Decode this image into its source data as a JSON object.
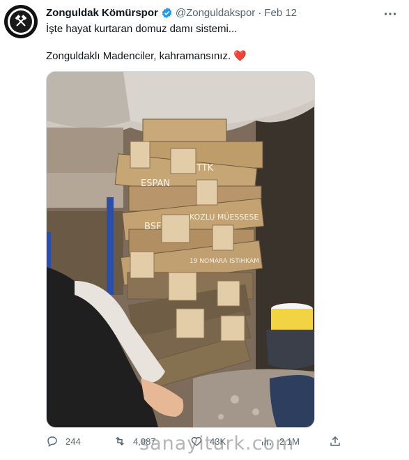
{
  "author": {
    "name": "Zonguldak Kömürspor",
    "handle": "@Zonguldakspor",
    "separator": "·",
    "date": "Feb 12",
    "verified": true
  },
  "tweet": {
    "line1": "İşte hayat kurtaran domuz damı sistemi...",
    "line2": "Zonguldaklı Madenciler, kahramansınız.",
    "emoji": "❤️"
  },
  "media": {
    "block_inscriptions": [
      "TTK",
      "ESPAN",
      "KOZLU MÜESSESE",
      "BSF",
      "19 NOMARA ISTIHKAM"
    ]
  },
  "actions": {
    "replies": "244",
    "retweets": "4,987",
    "likes": "43K",
    "views": "2.1M"
  },
  "watermark": "sanayiturk.com",
  "colors": {
    "text": "#0f1419",
    "secondary": "#536471",
    "verified": "#1d9bf0",
    "heart": "#e0245e"
  }
}
